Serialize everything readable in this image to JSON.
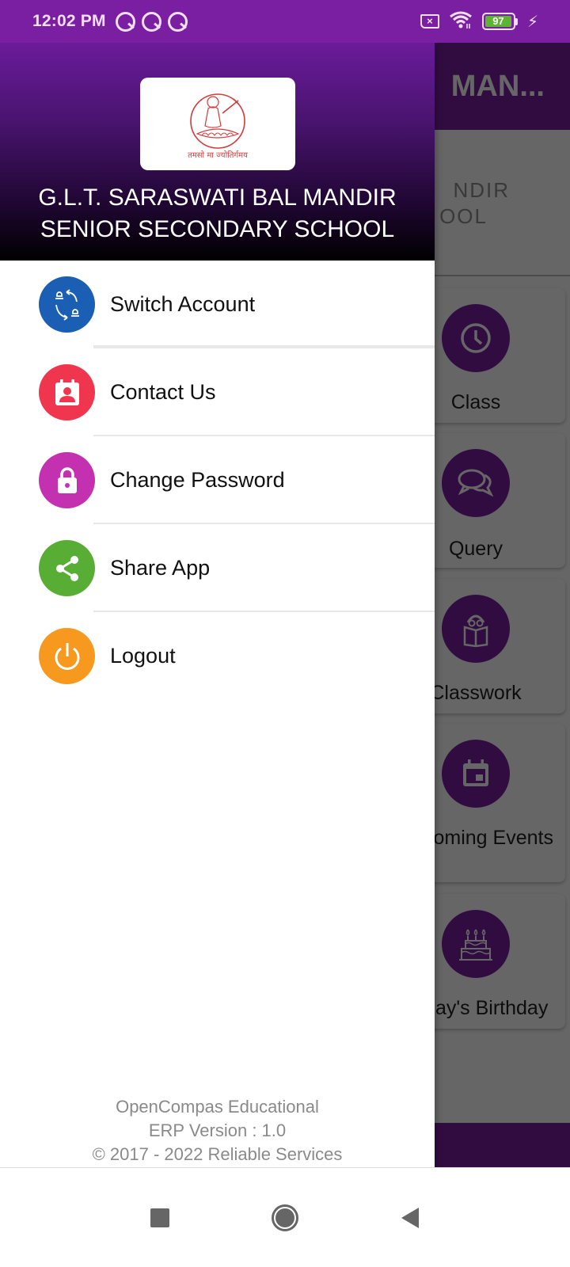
{
  "status_bar": {
    "time": "12:02 PM",
    "notification_icons": [
      "q-notification-icon",
      "q-notification-icon",
      "q-notification-icon"
    ],
    "battery_level": "97",
    "battery_percent": 97,
    "icons": [
      "no-sim-icon",
      "wifi-icon",
      "battery-icon",
      "charging-icon"
    ]
  },
  "background_app": {
    "toolbar_title": "MAN...",
    "school_line1": "NDIR",
    "school_line2": "OOL",
    "cards": [
      {
        "label": "Class",
        "icon": "clock-icon"
      },
      {
        "label": "Query",
        "icon": "chat-bubbles-icon"
      },
      {
        "label": "Classwork",
        "icon": "reading-student-icon"
      },
      {
        "label": "Upcoming Events",
        "icon": "calendar-icon"
      },
      {
        "label": "Today's Birthday",
        "icon": "birthday-cake-icon"
      }
    ]
  },
  "drawer": {
    "school_name_line1": "G.L.T. SARASWATI BAL MANDIR",
    "school_name_line2": "SENIOR SECONDARY SCHOOL",
    "logo_motto": "तमसो मा ज्योतिर्गमय",
    "menu": [
      {
        "label": "Switch Account",
        "icon": "switch-account-icon",
        "color": "#1a5fb4"
      },
      {
        "label": "Contact Us",
        "icon": "contact-card-icon",
        "color": "#f0364f"
      },
      {
        "label": "Change Password",
        "icon": "lock-icon",
        "color": "#c330b0"
      },
      {
        "label": "Share App",
        "icon": "share-icon",
        "color": "#58ad35"
      },
      {
        "label": "Logout",
        "icon": "power-icon",
        "color": "#f7991f"
      }
    ],
    "footer": {
      "line1": "OpenCompas Educational",
      "line2": "ERP Version : 1.0",
      "line3": "© 2017 - 2022 Reliable Services"
    }
  },
  "nav_bar": {
    "buttons": [
      "recents-button",
      "home-button",
      "back-button"
    ]
  }
}
